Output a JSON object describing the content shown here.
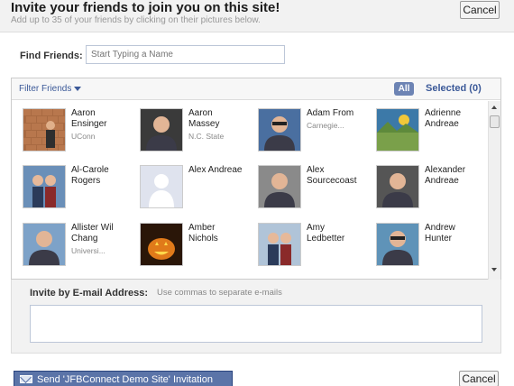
{
  "header": {
    "title": "Invite your friends to join you on this site!",
    "subtitle": "Add up to 35 of your friends by clicking on their pictures below.",
    "cancel_label": "Cancel"
  },
  "find": {
    "label": "Find Friends:",
    "placeholder": "Start Typing a Name"
  },
  "filter": {
    "label": "Filter Friends",
    "all_label": "All",
    "selected_label": "Selected (0)"
  },
  "friends": [
    {
      "first": "Aaron",
      "last": "Ensinger",
      "network": "UConn",
      "icon": "brick-wall-photo",
      "bg": "#a86a42"
    },
    {
      "first": "Aaron",
      "last": "Massey",
      "network": "N.C. State",
      "icon": "dark-portrait-photo",
      "bg": "#3a3a3a"
    },
    {
      "first": "Adam From",
      "last": "",
      "network": "Carnegie...",
      "icon": "man-glasses-photo",
      "bg": "#4a6fa0"
    },
    {
      "first": "Adrienne",
      "last": "Andreae",
      "network": "",
      "icon": "painting-photo",
      "bg": "#3c79a8"
    },
    {
      "first": "Al-Carole",
      "last": "Rogers",
      "network": "",
      "icon": "couple-photo",
      "bg": "#6a8fb8"
    },
    {
      "first": "Alex Andreae",
      "last": "",
      "network": "",
      "icon": "default-avatar-icon",
      "bg": "#dfe3ee"
    },
    {
      "first": "Alex",
      "last": "Sourcecoast",
      "network": "",
      "icon": "man-portrait-photo",
      "bg": "#8a8a8a"
    },
    {
      "first": "Alexander",
      "last": "Andreae",
      "network": "",
      "icon": "bw-portrait-photo",
      "bg": "#555555"
    },
    {
      "first": "Allister Wil",
      "last": "Chang",
      "network": "Universi...",
      "icon": "outdoor-photo",
      "bg": "#7da2c8"
    },
    {
      "first": "Amber",
      "last": "Nichols",
      "network": "",
      "icon": "pumpkin-photo",
      "bg": "#2a1608"
    },
    {
      "first": "Amy",
      "last": "Ledbetter",
      "network": "",
      "icon": "family-photo",
      "bg": "#b0c4d8"
    },
    {
      "first": "Andrew",
      "last": "Hunter",
      "network": "",
      "icon": "sunglasses-man-photo",
      "bg": "#5f93b8"
    }
  ],
  "email": {
    "label": "Invite by E-mail Address:",
    "hint": "Use commas to separate e-mails"
  },
  "footer": {
    "send_label": "Send 'JFBConnect Demo Site' Invitation",
    "cancel_label": "Cancel"
  }
}
